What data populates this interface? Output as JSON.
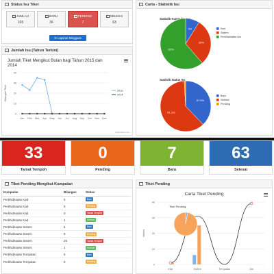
{
  "status_panel": {
    "title": "Status Isu Tiket",
    "buttons": [
      {
        "label": "JUMLAH",
        "value": "103",
        "icon": "list-icon",
        "active": false
      },
      {
        "label": "BARU",
        "value": "36",
        "icon": "ticket-icon",
        "active": false
      },
      {
        "label": "PENDING",
        "value": "7",
        "icon": "wrench-icon",
        "active": true
      },
      {
        "label": "SELESAI",
        "value": "63",
        "icon": "thumbs-up-icon",
        "active": false
      }
    ],
    "report_button": "Laporan Mingguan"
  },
  "monthly_panel": {
    "title": "Jumlah Isu (Tahun Terkini)",
    "chart_data": {
      "type": "line",
      "title": "Jumlah Tiket Mengikut Bulan bagi Tahun 2015 dan 2014",
      "ylabel": "Bilangan Tiket",
      "categories": [
        "Jan",
        "Feb",
        "Mar",
        "Apr",
        "May",
        "Jun",
        "Jul",
        "Aug",
        "Sep",
        "Oct",
        "Nov",
        "Dec"
      ],
      "ylim": [
        0,
        40
      ],
      "yticks": [
        "40",
        "30",
        "20",
        "10",
        "0"
      ],
      "series": [
        {
          "name": "2015",
          "color": "#7cb5ec",
          "values": [
            28,
            23,
            35,
            33,
            0,
            null,
            null,
            null,
            null,
            null,
            null,
            null
          ]
        },
        {
          "name": "2014",
          "color": "#434348",
          "values": [
            0,
            0,
            0,
            0,
            0,
            0,
            0,
            0,
            0,
            0,
            0,
            0
          ]
        }
      ],
      "credit": "Highcharts.com",
      "legend_position": "right"
    }
  },
  "pie_panel": {
    "title": "Carta - Statistik Isu",
    "charts": [
      {
        "type": "pie",
        "title": "Statistik Kumpulan Isu",
        "slices": [
          {
            "name": "Kad",
            "value": 9,
            "label": "9%",
            "color": "#3366cc"
          },
          {
            "name": "Sistem",
            "value": 30,
            "label": "30%",
            "color": "#dc3912"
          },
          {
            "name": "Perkhidmatan Am",
            "value": 62,
            "label": "62%",
            "color": "#33a02c"
          }
        ]
      },
      {
        "type": "pie",
        "title": "Statistik Status Isu",
        "slices": [
          {
            "name": "Baru",
            "value": 37.9,
            "label": "37.9%",
            "color": "#3366cc"
          },
          {
            "name": "Selesai",
            "value": 61.2,
            "label": "61.2%",
            "color": "#dc3912"
          },
          {
            "name": "Pending",
            "value": 0.9,
            "label": "",
            "color": "#ff9900"
          }
        ]
      }
    ]
  },
  "tiles": [
    {
      "value": "33",
      "caption": "Tamat Tempoh",
      "color": "#d9251d"
    },
    {
      "value": "0",
      "caption": "Pending",
      "color": "#e8661a"
    },
    {
      "value": "7",
      "caption": "Baru",
      "color": "#7fb332"
    },
    {
      "value": "63",
      "caption": "Selesai",
      "color": "#2d6bb3"
    }
  ],
  "pending_table": {
    "title": "Tiket Pending Mengikut Kumpulan",
    "headers": [
      "Kumpulan",
      "Bilangan",
      "Status"
    ],
    "rows": [
      {
        "group": "Perkhidmatan Kad",
        "count": "0",
        "status": "Baru",
        "color": "#337ab7"
      },
      {
        "group": "Perkhidmatan Kad",
        "count": "0",
        "status": "Pending",
        "color": "#f0ad4e"
      },
      {
        "group": "Perkhidmatan Kad",
        "count": "0",
        "status": "Tamat Tempoh",
        "color": "#d9534f"
      },
      {
        "group": "Perkhidmatan Kad",
        "count": "1",
        "status": "Selesai",
        "color": "#5cb85c"
      },
      {
        "group": "Perkhidmatan Sistem",
        "count": "6",
        "status": "Baru",
        "color": "#337ab7"
      },
      {
        "group": "Perkhidmatan Sistem",
        "count": "0",
        "status": "Pending",
        "color": "#f0ad4e"
      },
      {
        "group": "Perkhidmatan Sistem",
        "count": "25",
        "status": "Tamat Tempoh",
        "color": "#d9534f"
      },
      {
        "group": "Perkhidmatan Sistem",
        "count": "1",
        "status": "Selesai",
        "color": "#5cb85c"
      },
      {
        "group": "Perkhidmatan Tempatan",
        "count": "0",
        "status": "Baru",
        "color": "#337ab7"
      },
      {
        "group": "Perkhidmatan Tempatan",
        "count": "0",
        "status": "Pending",
        "color": "#f0ad4e"
      }
    ]
  },
  "pending_chart_panel": {
    "title": "Tiket Pending",
    "chart_data": {
      "type": "bar",
      "title": "Carta Tiket Pending",
      "ylabel": "Values",
      "categories": [
        "Kad",
        "Sistem",
        "Tempatan",
        "Am"
      ],
      "ylim": [
        0,
        40
      ],
      "yticks": [
        "40",
        "30",
        "20",
        "10",
        "0"
      ],
      "series": [
        {
          "name": "Baru",
          "color": "#7cb5ec",
          "values": [
            0,
            6,
            0,
            0
          ]
        },
        {
          "name": "Pending",
          "color": "#f7a35c",
          "values": [
            1,
            25,
            0,
            0
          ]
        }
      ],
      "inset_pie": {
        "title": "Tiket Pending",
        "slices": [
          {
            "name": "Kad",
            "value": 3,
            "color": "#7cb5ec"
          },
          {
            "name": "Sistem",
            "value": 97,
            "color": "#f7a35c"
          }
        ]
      }
    }
  }
}
